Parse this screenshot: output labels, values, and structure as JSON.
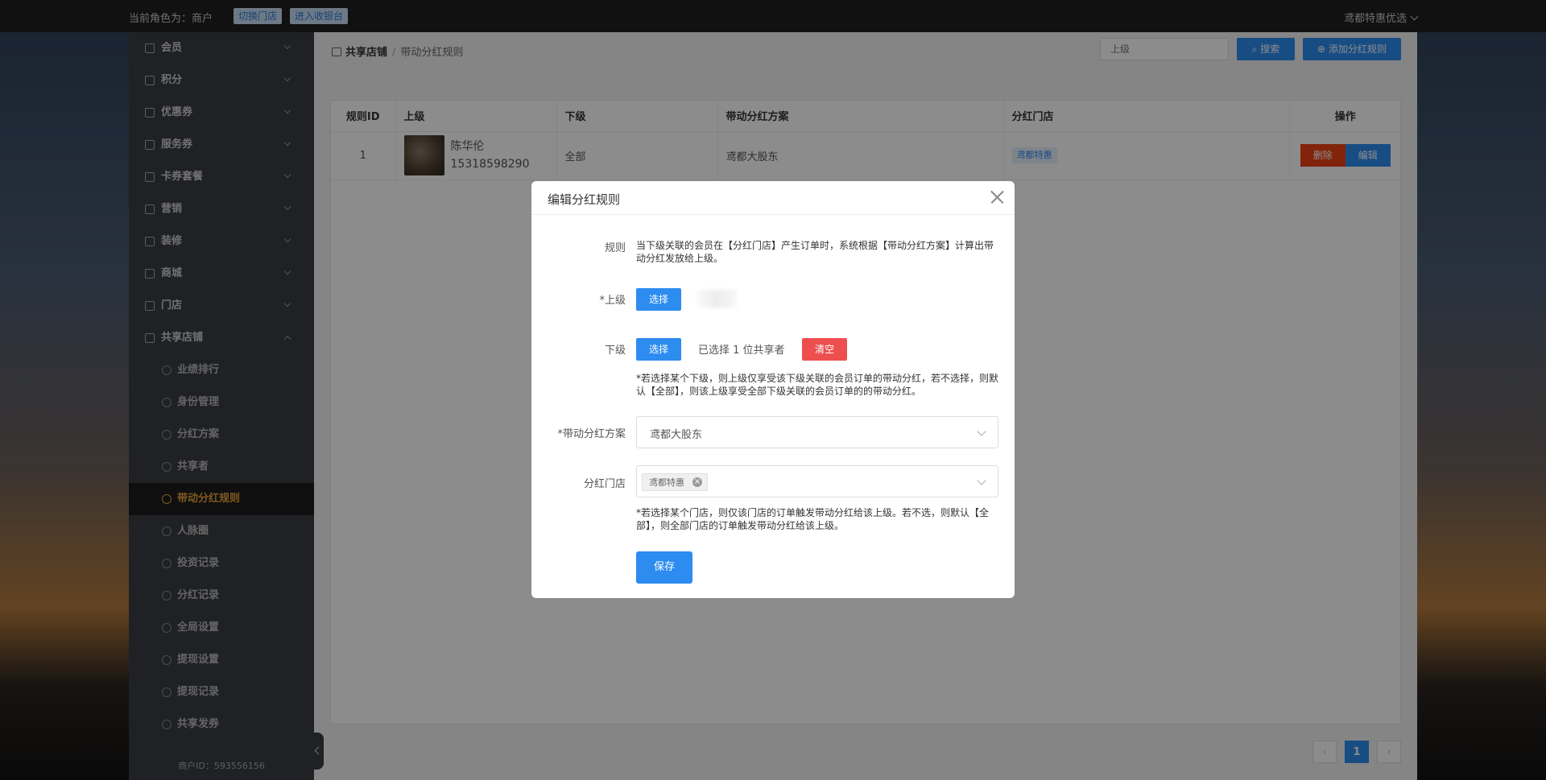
{
  "topbar": {
    "role_text": "当前角色为：商户",
    "switch_store": "切换门店",
    "enter_cashier": "进入收银台",
    "store_name": "鸢都特惠优选"
  },
  "sidebar": {
    "items": [
      {
        "label": "会员",
        "icon": "member-icon"
      },
      {
        "label": "积分",
        "icon": "points-icon"
      },
      {
        "label": "优惠券",
        "icon": "coupon-icon"
      },
      {
        "label": "服务券",
        "icon": "service-ticket-icon"
      },
      {
        "label": "卡券套餐",
        "icon": "card-package-icon"
      },
      {
        "label": "营销",
        "icon": "marketing-icon"
      },
      {
        "label": "装修",
        "icon": "decoration-icon"
      },
      {
        "label": "商城",
        "icon": "mall-icon"
      },
      {
        "label": "门店",
        "icon": "store-icon"
      },
      {
        "label": "共享店铺",
        "icon": "shared-store-icon"
      }
    ],
    "sub_items": [
      {
        "label": "业绩排行"
      },
      {
        "label": "身份管理"
      },
      {
        "label": "分红方案"
      },
      {
        "label": "共享者"
      },
      {
        "label": "带动分红规则"
      },
      {
        "label": "人脉圈"
      },
      {
        "label": "投资记录"
      },
      {
        "label": "分红记录"
      },
      {
        "label": "全局设置"
      },
      {
        "label": "提现设置"
      },
      {
        "label": "提现记录"
      },
      {
        "label": "共享发券"
      }
    ],
    "merchant_id": "商户ID：593556156"
  },
  "header": {
    "breadcrumb_1": "共享店铺",
    "breadcrumb_sep": "/",
    "breadcrumb_2": "带动分红规则",
    "search_placeholder": "上级",
    "search_btn": "搜索",
    "add_btn": "添加分红规则"
  },
  "table": {
    "columns": [
      "规则ID",
      "上级",
      "下级",
      "带动分红方案",
      "分红门店",
      "操作"
    ],
    "rows": [
      {
        "id": "1",
        "superior_name": "陈华伦",
        "superior_phone": "15318598290",
        "subordinate": "全部",
        "plan": "鸢都大股东",
        "store_tag": "鸢都特惠",
        "delete_btn": "删除",
        "edit_btn": "编辑"
      }
    ]
  },
  "pagination": {
    "current": "1"
  },
  "modal": {
    "title": "编辑分红规则",
    "rule_label": "规则",
    "rule_text": "当下级关联的会员在【分红门店】产生订单时，系统根据【带动分红方案】计算出带动分红发放给上级。",
    "superior_label": "*上级",
    "select_btn": "选择",
    "subordinate_label": "下级",
    "selected_count": "已选择 1 位共享者",
    "clear_btn": "清空",
    "subordinate_hint": "*若选择某个下级，则上级仅享受该下级关联的会员订单的带动分红，若不选择，则默认【全部】，则该上级享受全部下级关联的会员订单的的带动分红。",
    "plan_label": "*带动分红方案",
    "plan_value": "鸢都大股东",
    "store_label": "分红门店",
    "store_chip": "鸢都特惠",
    "store_hint": "*若选择某个门店，则仅该门店的订单触发带动分红给该上级。若不选，则默认【全部】，则全部门店的订单触发带动分红给该上级。",
    "save_btn": "保存"
  }
}
